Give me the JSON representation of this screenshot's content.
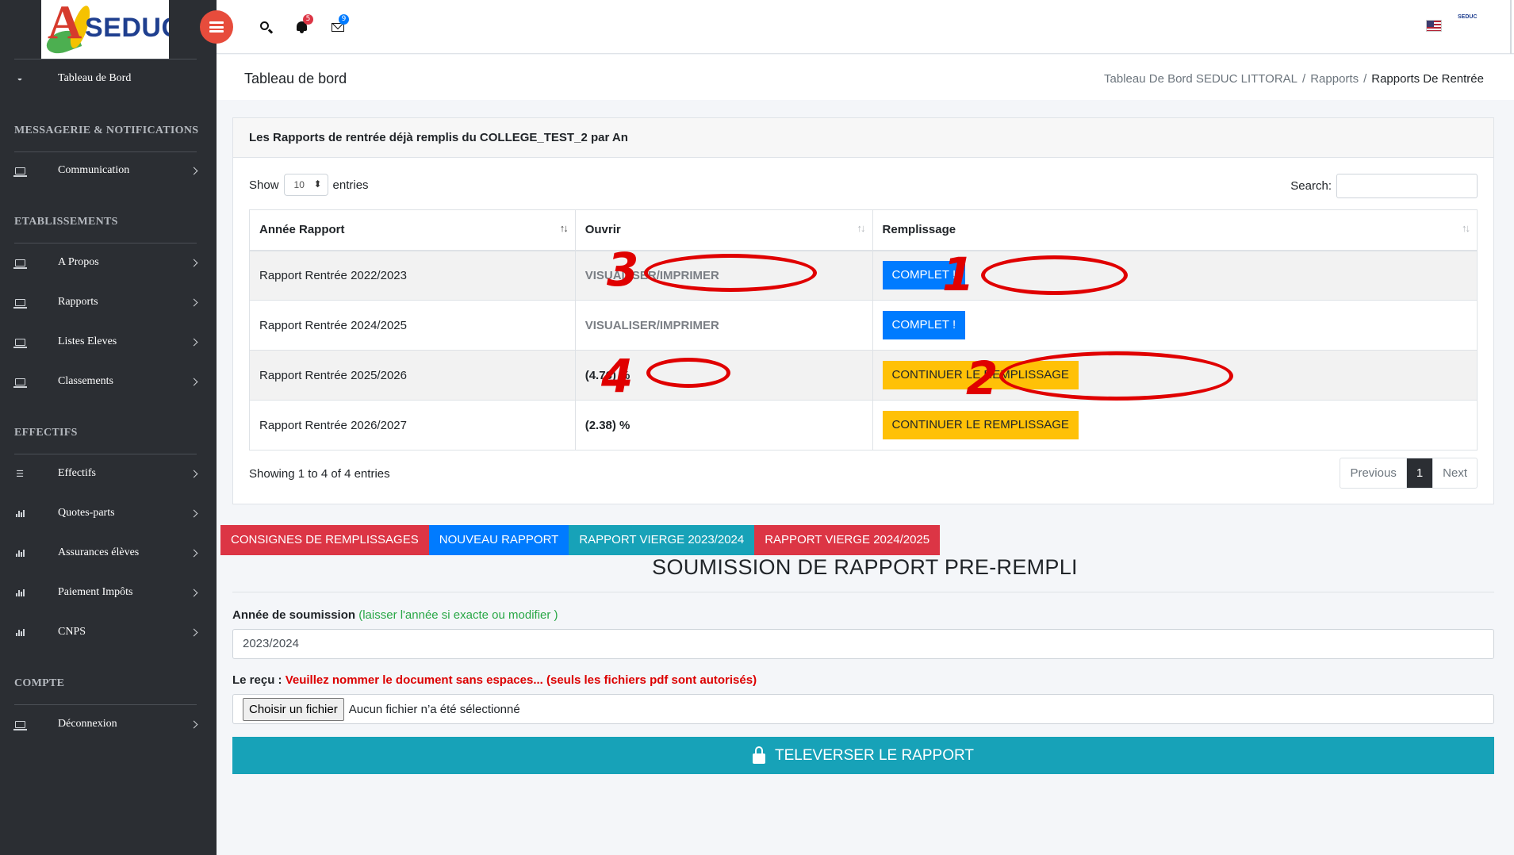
{
  "brand": {
    "logo_text": "SEDUC"
  },
  "topbar": {
    "notifications_count": "5",
    "messages_count": "9",
    "notifications_color": "#dc3545",
    "messages_color": "#007bff"
  },
  "sidebar": {
    "dashboard": "Tableau de Bord",
    "sections": {
      "messaging": "MESSAGERIE & NOTIFICATIONS",
      "establishments": "ETABLISSEMENTS",
      "effectifs": "EFFECTIFS",
      "compte": "COMPTE"
    },
    "items": {
      "communication": "Communication",
      "apropos": "A Propos",
      "rapports": "Rapports",
      "listes": "Listes Eleves",
      "classements": "Classements",
      "effectifs": "Effectifs",
      "quotes": "Quotes-parts",
      "assurances": "Assurances élèves",
      "paiement": "Paiement Impôts",
      "cnps": "CNPS",
      "deconnexion": "Déconnexion"
    }
  },
  "header": {
    "title": "Tableau de bord",
    "breadcrumb": [
      "Tableau De Bord SEDUC LITTORAL",
      "Rapports",
      "Rapports De Rentrée"
    ],
    "sep": "/"
  },
  "card": {
    "title": "Les Rapports de rentrée déjà remplis du COLLEGE_TEST_2 par An",
    "show_label": "Show",
    "entries_value": "10",
    "entries_label": "entries",
    "search_label": "Search:",
    "columns": [
      "Année Rapport",
      "Ouvrir",
      "Remplissage"
    ],
    "rows": [
      {
        "year": "Rapport Rentrée 2022/2023",
        "open": "VISUALISER/IMPRIMER",
        "action": "COMPLET !"
      },
      {
        "year": "Rapport Rentrée 2024/2025",
        "open": "VISUALISER/IMPRIMER",
        "action": "COMPLET !"
      },
      {
        "year": "Rapport Rentrée 2025/2026",
        "open": "(4.76) %",
        "action": "CONTINUER LE REMPLISSAGE"
      },
      {
        "year": "Rapport Rentrée 2026/2027",
        "open": "(2.38) %",
        "action": "CONTINUER LE REMPLISSAGE"
      }
    ],
    "info": "Showing 1 to 4 of 4 entries",
    "pager": {
      "prev": "Previous",
      "page": "1",
      "next": "Next"
    }
  },
  "tabs": [
    "CONSIGNES DE REMPLISSAGES",
    "NOUVEAU RAPPORT",
    "RAPPORT VIERGE 2023/2024",
    "RAPPORT VIERGE 2024/2025"
  ],
  "submission": {
    "title": "SOUMISSION DE RAPPORT PRE-REMPLI",
    "year_label": "Année de soumission",
    "year_hint": "(laisser l'année si exacte ou modifier )",
    "year_value": "2023/2024",
    "receipt_label": "Le reçu :",
    "receipt_hint": "Veuillez nommer le document sans espaces... (seuls les fichiers pdf sont autorisés)",
    "file_button": "Choisir un fichier",
    "file_status": "Aucun fichier n’a été sélectionné",
    "upload_label": "TELEVERSER LE RAPPORT"
  },
  "annotations": [
    "1",
    "2",
    "3",
    "4"
  ],
  "colors": {
    "sidebar": "#2b2e33",
    "primary": "#007bff",
    "warning": "#ffc107",
    "danger": "#dc3545",
    "info": "#17a2b8",
    "annotation": "#e00000"
  }
}
